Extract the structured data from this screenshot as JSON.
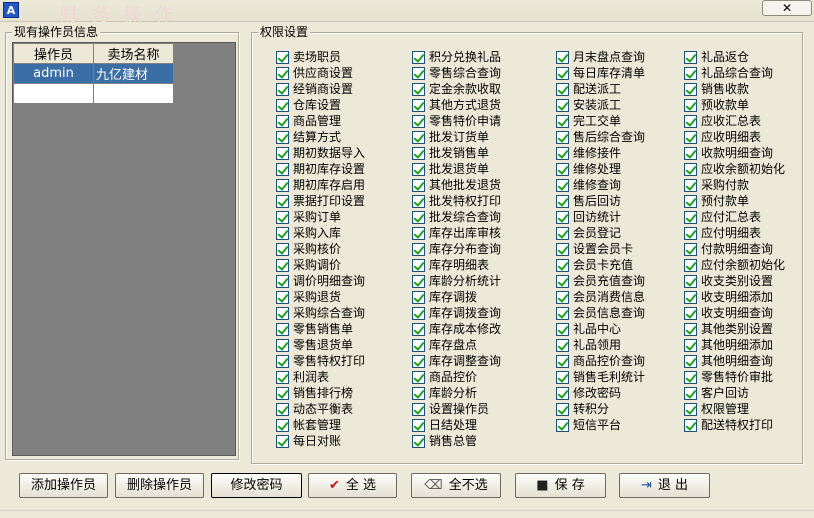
{
  "window": {
    "app_icon_label": "A",
    "ghost_title": "财 务 操 作",
    "close_label": "✕"
  },
  "operators": {
    "group_title": "现有操作员信息",
    "columns": [
      "操作员",
      "卖场名称"
    ],
    "rows": [
      {
        "user": "admin",
        "store": "九亿建材",
        "selected": true
      },
      {
        "user": "",
        "store": "",
        "selected": false
      }
    ]
  },
  "permissions": {
    "group_title": "权限设置",
    "columns": [
      [
        "卖场职员",
        "供应商设置",
        "经销商设置",
        "仓库设置",
        "商品管理",
        "结算方式",
        "期初数据导入",
        "期初库存设置",
        "期初库存启用",
        "票据打印设置",
        "采购订单",
        "采购入库",
        "采购核价",
        "采购调价",
        "调价明细查询",
        "采购退货",
        "采购综合查询",
        "零售销售单",
        "零售退货单",
        "零售特权打印",
        "利润表",
        "销售排行榜",
        "动态平衡表",
        "帐套管理",
        "每日对账"
      ],
      [
        "积分兑换礼品",
        "零售综合查询",
        "定金余款收取",
        "其他方式退货",
        "零售特价申请",
        "批发订货单",
        "批发销售单",
        "批发退货单",
        "其他批发退货",
        "批发特权打印",
        "批发综合查询",
        "库存出库审核",
        "库存分布查询",
        "库存明细表",
        "库龄分析统计",
        "库存调拨",
        "库存调拨查询",
        "库存成本修改",
        "库存盘点",
        "库存调整查询",
        "商品控价",
        "库龄分析",
        "设置操作员",
        "日结处理",
        "销售总管"
      ],
      [
        "月末盘点查询",
        "每日库存清单",
        "配送派工",
        "安装派工",
        "完工交单",
        "售后综合查询",
        "维修接件",
        "维修处理",
        "维修查询",
        "售后回访",
        "回访统计",
        "会员登记",
        "设置会员卡",
        "会员卡充值",
        "会员充值查询",
        "会员消费信息",
        "会员信息查询",
        "礼品中心",
        "礼品领用",
        "商品控价查询",
        "销售毛利统计",
        "修改密码",
        "转积分",
        "短信平台"
      ],
      [
        "礼品返仓",
        "礼品综合查询",
        "销售收款",
        "预收款单",
        "应收汇总表",
        "应收明细表",
        "收款明细查询",
        "应收余额初始化",
        "采购付款",
        "预付款单",
        "应付汇总表",
        "应付明细表",
        "付款明细查询",
        "应付余额初始化",
        "收支类别设置",
        "收支明细添加",
        "收支明细查询",
        "其他类别设置",
        "其他明细添加",
        "其他明细查询",
        "零售特价审批",
        "客户回访",
        "权限管理",
        "配送特权打印"
      ]
    ]
  },
  "buttons": {
    "add_operator": "添加操作员",
    "delete_operator": "删除操作员",
    "change_password": "修改密码",
    "select_all": "全 选",
    "select_none": "全不选",
    "save": "保 存",
    "exit": "退 出"
  },
  "icons": {
    "select_all": "check-icon",
    "select_none": "eraser-icon",
    "save": "floppy-icon",
    "exit": "exit-door-icon"
  }
}
